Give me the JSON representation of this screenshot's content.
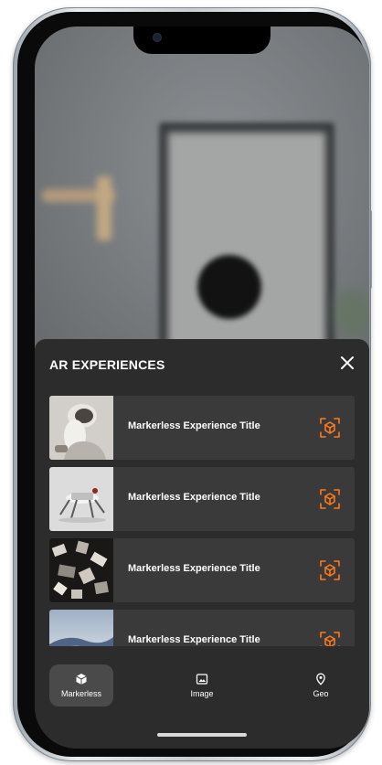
{
  "sheet": {
    "title": "AR EXPERIENCES",
    "close_icon": "close-icon"
  },
  "experiences": [
    {
      "title": "Markerless Experience Title",
      "icon": "ar-cube-icon"
    },
    {
      "title": "Markerless Experience Title",
      "icon": "ar-cube-icon"
    },
    {
      "title": "Markerless Experience Title",
      "icon": "ar-cube-icon"
    },
    {
      "title": "Markerless Experience Title",
      "icon": "ar-cube-icon"
    }
  ],
  "tabs": [
    {
      "label": "Markerless",
      "icon": "cube-icon",
      "active": true
    },
    {
      "label": "Image",
      "icon": "image-icon",
      "active": false
    },
    {
      "label": "Geo",
      "icon": "location-pin-icon",
      "active": false
    }
  ],
  "colors": {
    "accent": "#ff7a1a",
    "sheet_bg": "#2c2c2c",
    "card_bg": "#3a3a3a",
    "active_tab_bg": "#4a4a4a"
  }
}
